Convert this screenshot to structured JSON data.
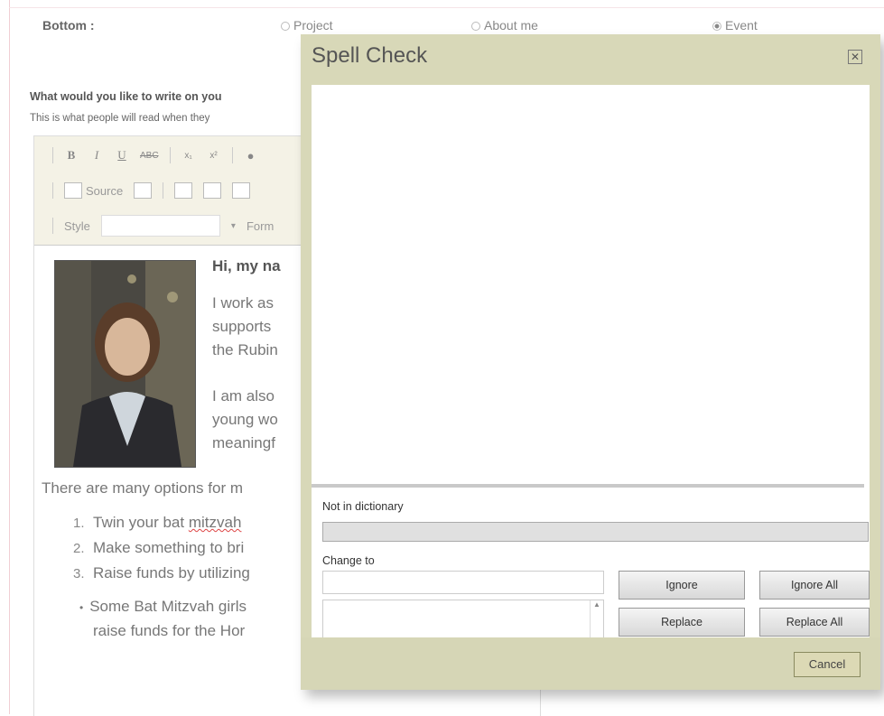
{
  "radio": {
    "label": "Bottom :",
    "options": [
      "Project",
      "About me",
      "Event"
    ],
    "selected": "Event"
  },
  "prompt": {
    "question": "What would you like to write on you",
    "subtitle": "This is what people will read when they"
  },
  "toolbar": {
    "bold": "B",
    "italic": "I",
    "underline": "U",
    "strike": "ABC",
    "subscript": "x₁",
    "superscript": "x²",
    "source": "Source",
    "style_label": "Style",
    "format_label": "Form"
  },
  "content": {
    "greeting": "Hi, my na",
    "para1": [
      "I work as",
      "supports",
      "the Rubin"
    ],
    "para2": [
      "I am also",
      "young wo",
      "meaningf"
    ],
    "options_line": "There are many options for m",
    "list": [
      {
        "num": "1.",
        "pre": "Twin your bat ",
        "mark": "mitzvah",
        "post": ""
      },
      {
        "num": "2.",
        "pre": "Make something to bri",
        "mark": "",
        "post": ""
      },
      {
        "num": "3.",
        "pre": "Raise funds by utilizing",
        "mark": "",
        "post": ""
      }
    ],
    "bullet": [
      "Some Bat Mitzvah girls",
      "raise funds for the Hor"
    ]
  },
  "dialog": {
    "title": "Spell Check",
    "not_in_dictionary": "Not in dictionary",
    "change_to": "Change to",
    "ignore": "Ignore",
    "ignore_all": "Ignore All",
    "replace": "Replace",
    "replace_all": "Replace All",
    "cancel": "Cancel"
  }
}
